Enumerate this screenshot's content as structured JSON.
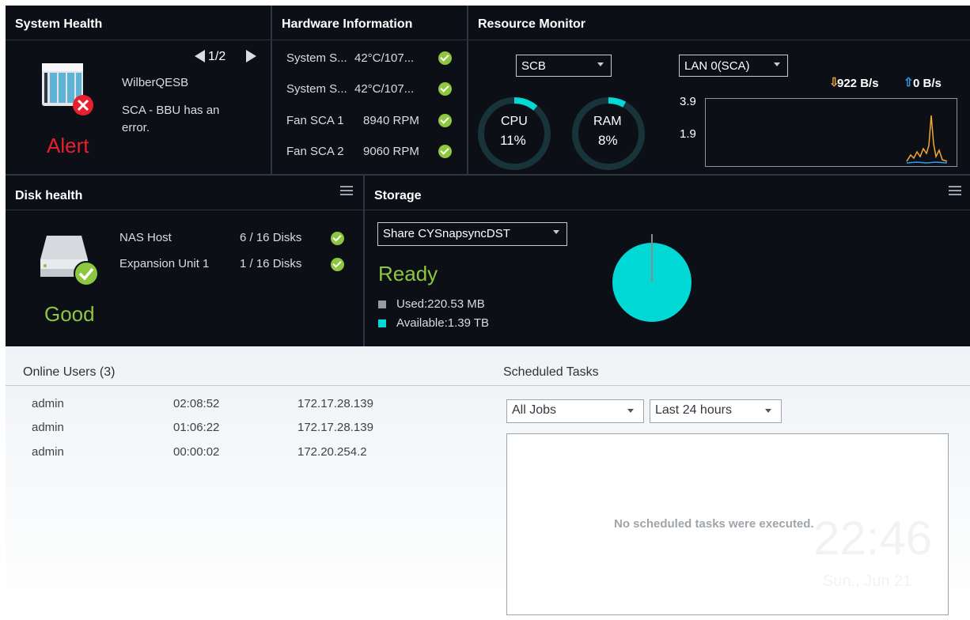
{
  "system_health": {
    "title": "System Health",
    "pager": "1/2",
    "device_name": "WilberQESB",
    "message": "SCA - BBU has an error.",
    "status": "Alert",
    "status_color": "#e8202e"
  },
  "hardware": {
    "title": "Hardware Information",
    "rows": [
      {
        "label": "System S...",
        "value": "42°C/107..."
      },
      {
        "label": "System S...",
        "value": "42°C/107..."
      },
      {
        "label": "Fan SCA 1",
        "value": "8940 RPM"
      },
      {
        "label": "Fan SCA 2",
        "value": "9060 RPM"
      }
    ]
  },
  "resource": {
    "title": "Resource Monitor",
    "unit_select": "SCB",
    "lan_select": "LAN 0(SCA)",
    "cpu_label": "CPU",
    "cpu_value": "11%",
    "cpu_percent": 11,
    "ram_label": "RAM",
    "ram_value": "8%",
    "ram_percent": 8,
    "download": "922 B/s",
    "upload": "0 B/s",
    "y_ticks": [
      "3.9",
      "1.9"
    ],
    "accent": "#00d9d5"
  },
  "disk": {
    "title": "Disk health",
    "rows": [
      {
        "label": "NAS Host",
        "value": "6 / 16 Disks"
      },
      {
        "label": "Expansion Unit 1",
        "value": "1 / 16 Disks"
      }
    ],
    "status": "Good",
    "status_color": "#8dc63f"
  },
  "storage": {
    "title": "Storage",
    "share_select": "Share CYSnapsyncDST",
    "status": "Ready",
    "used": "Used:220.53 MB",
    "available": "Available:1.39 TB",
    "used_color": "#9a9a9a",
    "available_color": "#00d9d5"
  },
  "online_users": {
    "title": "Online Users (3)",
    "rows": [
      {
        "user": "admin",
        "time": "02:08:52",
        "ip": "172.17.28.139"
      },
      {
        "user": "admin",
        "time": "01:06:22",
        "ip": "172.17.28.139"
      },
      {
        "user": "admin",
        "time": "00:00:02",
        "ip": "172.20.254.2"
      }
    ]
  },
  "scheduled_tasks": {
    "title": "Scheduled Tasks",
    "job_filter": "All Jobs",
    "time_filter": "Last 24 hours",
    "empty_message": "No scheduled tasks were executed."
  },
  "clock": {
    "time": "22:46",
    "date": "Sun., Jun 21"
  }
}
